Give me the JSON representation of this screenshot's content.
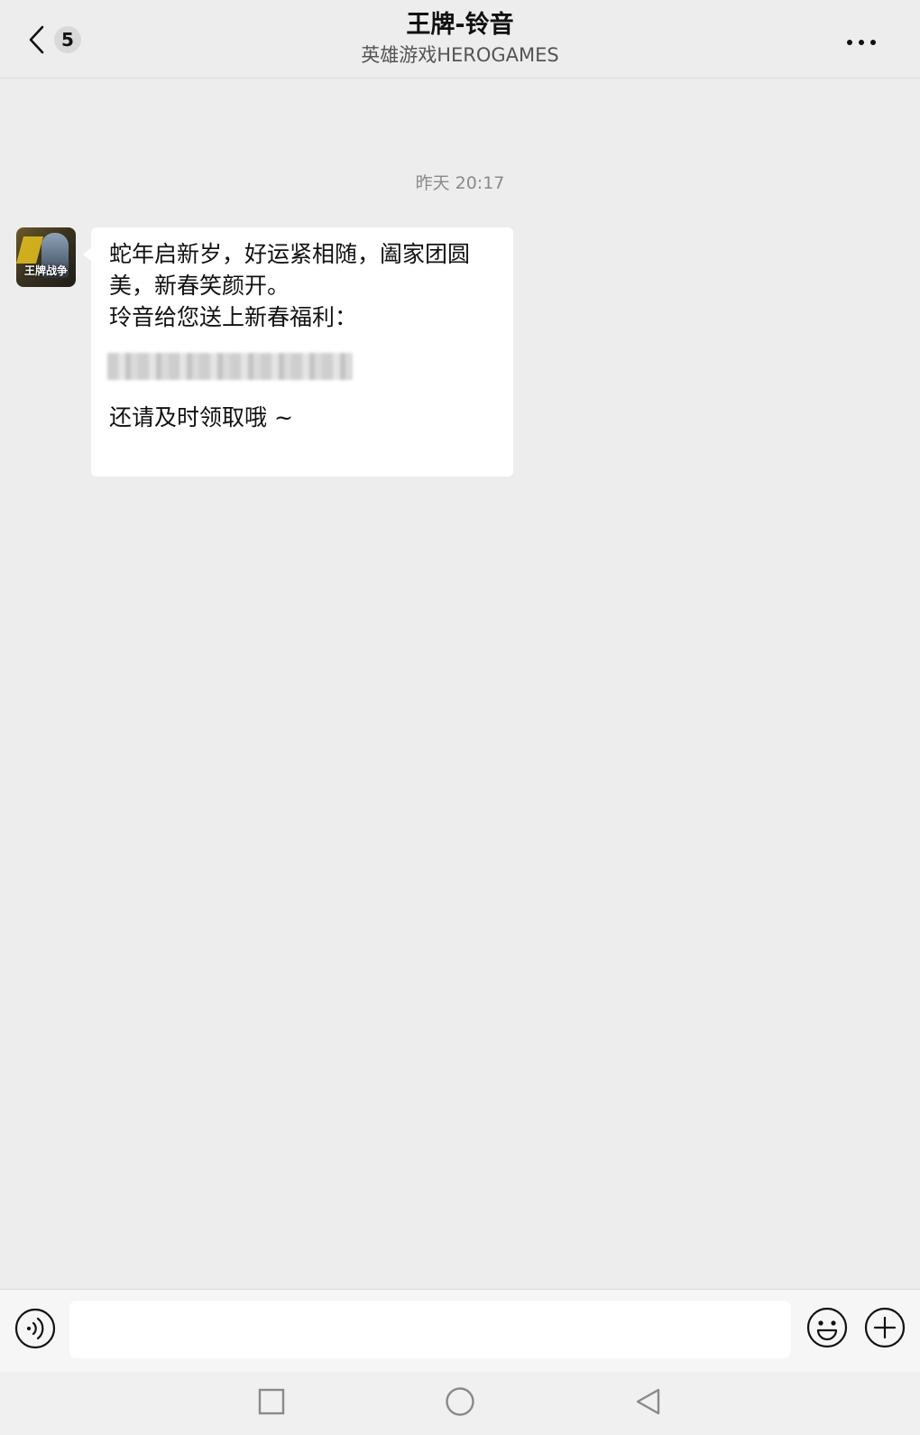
{
  "header": {
    "unread_count": "5",
    "title": "王牌-铃音",
    "subtitle": "英雄游戏HEROGAMES"
  },
  "chat": {
    "timestamp": "昨天 20:17",
    "sender_avatar_text": "王牌战争",
    "message": {
      "line1": "蛇年启新岁，好运紧相随，阖家团圆",
      "line2": "美，新春笑颜开。",
      "line3": "玲音给您送上新春福利：",
      "line4": "还请及时领取哦 ~"
    }
  },
  "input": {
    "value": "",
    "placeholder": ""
  },
  "icons": {
    "back": "chevron-left-icon",
    "more": "more-dots-icon",
    "voice": "voice-icon",
    "emoji": "emoji-icon",
    "plus": "plus-icon",
    "recents": "square-icon",
    "home": "circle-icon",
    "nav_back": "triangle-back-icon"
  },
  "colors": {
    "background": "#ededed",
    "bubble": "#ffffff",
    "badge": "#d9d9d9"
  }
}
